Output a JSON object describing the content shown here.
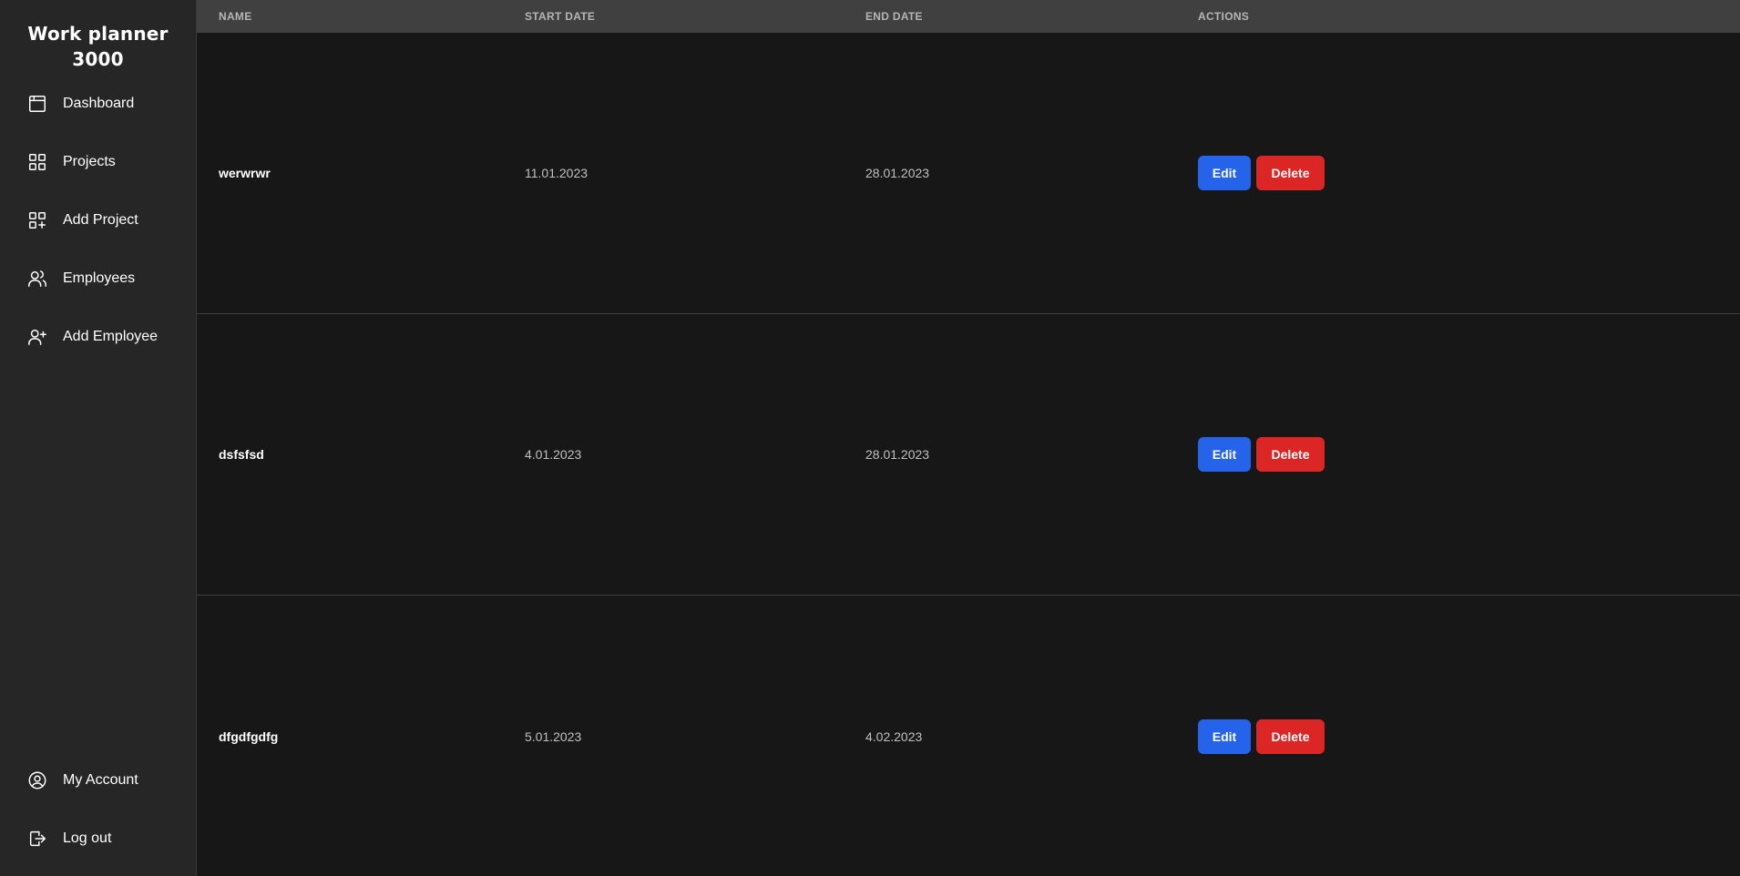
{
  "app": {
    "title": "Work planner 3000"
  },
  "sidebar": {
    "items": [
      {
        "label": "Dashboard",
        "icon": "calendar-icon"
      },
      {
        "label": "Projects",
        "icon": "grid-icon"
      },
      {
        "label": "Add Project",
        "icon": "grid-plus-icon"
      },
      {
        "label": "Employees",
        "icon": "users-icon"
      },
      {
        "label": "Add Employee",
        "icon": "user-plus-icon"
      }
    ],
    "bottom_items": [
      {
        "label": "My Account",
        "icon": "user-circle-icon"
      },
      {
        "label": "Log out",
        "icon": "logout-icon"
      }
    ]
  },
  "table": {
    "headers": {
      "name": "NAME",
      "start_date": "START DATE",
      "end_date": "END DATE",
      "actions": "ACTIONS"
    },
    "rows": [
      {
        "name": "werwrwr",
        "start_date": "11.01.2023",
        "end_date": "28.01.2023",
        "edit_label": "Edit",
        "delete_label": "Delete"
      },
      {
        "name": "dsfsfsd",
        "start_date": "4.01.2023",
        "end_date": "28.01.2023",
        "edit_label": "Edit",
        "delete_label": "Delete"
      },
      {
        "name": "dfgdfgdfg",
        "start_date": "5.01.2023",
        "end_date": "4.02.2023",
        "edit_label": "Edit",
        "delete_label": "Delete"
      }
    ]
  },
  "colors": {
    "edit_button": "#2563eb",
    "delete_button": "#dc2626",
    "sidebar_bg": "#262626",
    "main_bg": "#171717",
    "header_bg": "#404040"
  }
}
